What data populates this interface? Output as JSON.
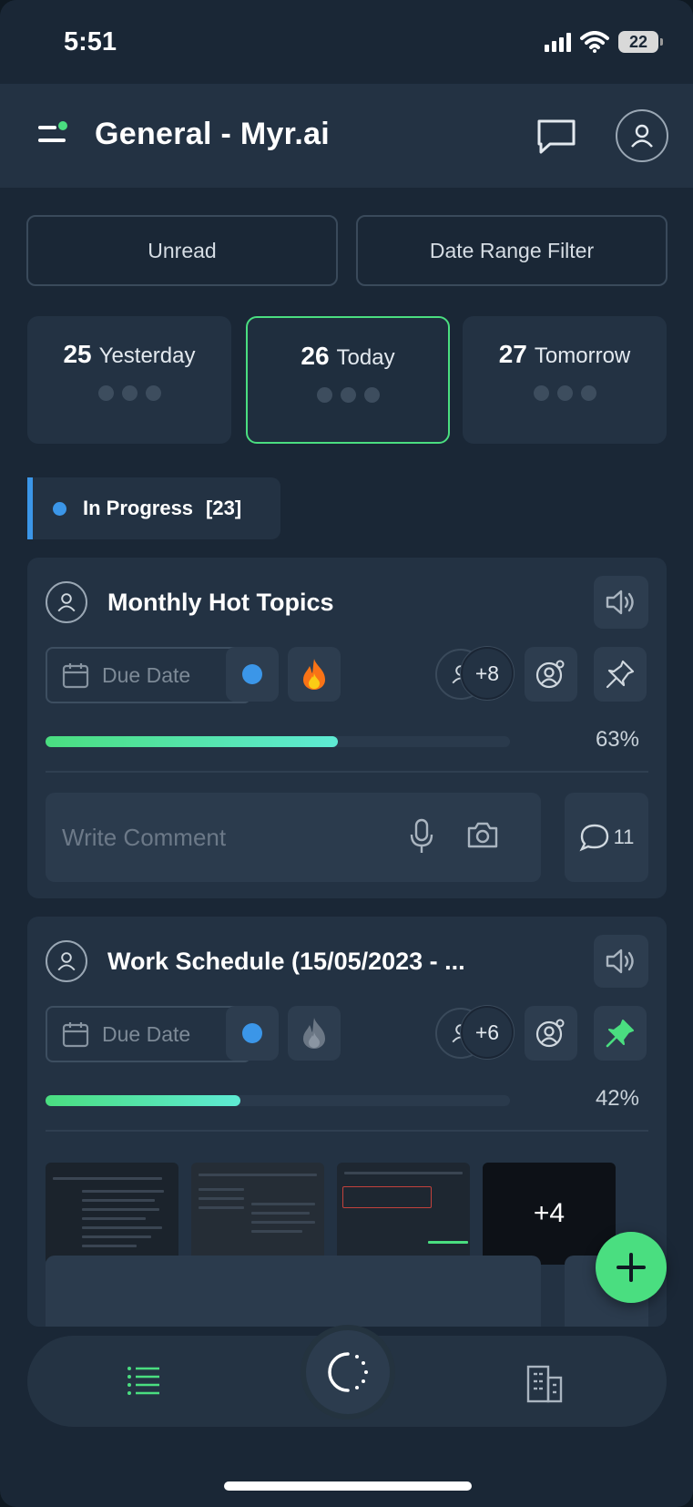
{
  "status_bar": {
    "time": "5:51",
    "battery": "22"
  },
  "header": {
    "title": "General - Myr.ai"
  },
  "filters": {
    "unread": "Unread",
    "date_range": "Date Range Filter"
  },
  "days": [
    {
      "day": "25",
      "label": "Yesterday"
    },
    {
      "day": "26",
      "label": "Today",
      "selected": true
    },
    {
      "day": "27",
      "label": "Tomorrow"
    }
  ],
  "section": {
    "label": "In Progress",
    "count": "[23]",
    "color": "#3b96e8"
  },
  "tasks": [
    {
      "title": "Monthly Hot Topics",
      "due_placeholder": "Due Date",
      "members_more": "+8",
      "progress": 0.63,
      "progress_label": "63%",
      "comment_placeholder": "Write Comment",
      "comment_count": "11",
      "priority_icon": "fire-icon-active",
      "pinned": false
    },
    {
      "title": "Work Schedule (15/05/2023 - ...",
      "due_placeholder": "Due Date",
      "members_more": "+6",
      "progress": 0.42,
      "progress_label": "42%",
      "attachments_more": "+4",
      "priority_icon": "fire-icon-inactive",
      "pinned": true
    }
  ],
  "colors": {
    "accent": "#4ade80",
    "background": "#1a2736",
    "card": "#233243"
  }
}
